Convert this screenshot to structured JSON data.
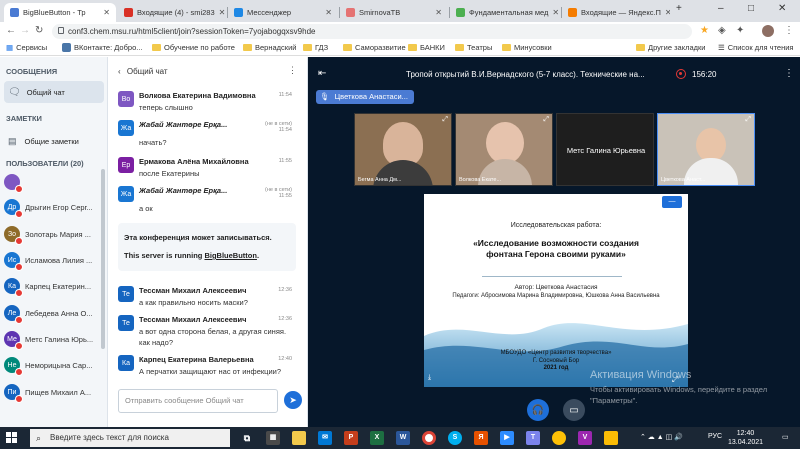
{
  "browser": {
    "tabs": [
      {
        "label": "BigBlueButton - Тр",
        "color": "#4b7bd3",
        "active": true
      },
      {
        "label": "Входящие (4) - smi283",
        "color": "#d93025",
        "active": false
      },
      {
        "label": "Мессенджер",
        "color": "#1e88e5",
        "active": false
      },
      {
        "label": "SmirnovaTB",
        "color": "#e57373",
        "active": false
      },
      {
        "label": "Фундаментальная мед",
        "color": "#4caf50",
        "active": false
      },
      {
        "label": "Входящие — Яндекс.П",
        "color": "#f57c00",
        "active": false
      }
    ],
    "url": "conf3.chem.msu.ru/html5client/join?sessionToken=7yojabogqxsv9hde",
    "bookmarks": [
      {
        "label": "Сервисы",
        "kind": "apps"
      },
      {
        "label": "ВКонтакте: Добро...",
        "kind": "vk"
      },
      {
        "label": "Обучение по работе",
        "kind": "folder"
      },
      {
        "label": "Вернадский",
        "kind": "folder"
      },
      {
        "label": "ГДЗ",
        "kind": "folder"
      },
      {
        "label": "Саморазвитие",
        "kind": "folder"
      },
      {
        "label": "БАНКИ",
        "kind": "folder"
      },
      {
        "label": "Театры",
        "kind": "folder"
      },
      {
        "label": "Минусовки",
        "kind": "folder"
      },
      {
        "label": "Другие закладки",
        "kind": "folder"
      },
      {
        "label": "Список для чтения",
        "kind": "list"
      }
    ]
  },
  "sidebar": {
    "messages_heading": "СООБЩЕНИЯ",
    "public_chat": "Общий чат",
    "notes_heading": "ЗАМЕТКИ",
    "shared_notes": "Общие заметки",
    "users_heading": "ПОЛЬЗОВАТЕЛИ (20)",
    "users": [
      {
        "initials": "",
        "name": "",
        "color": "#7e57c2"
      },
      {
        "initials": "Др",
        "name": "Дрыгин Егор Серг...",
        "color": "#1976d2"
      },
      {
        "initials": "Зо",
        "name": "Золотарь Мария ...",
        "color": "#8e6b2a"
      },
      {
        "initials": "Ис",
        "name": "Исламова Лилия ...",
        "color": "#1976d2"
      },
      {
        "initials": "Ка",
        "name": "Карпец Екатерин...",
        "color": "#1565c0"
      },
      {
        "initials": "Ле",
        "name": "Лебедева Анна О...",
        "color": "#1565c0"
      },
      {
        "initials": "Ме",
        "name": "Метс Галина Юрь...",
        "color": "#5e35b1"
      },
      {
        "initials": "Не",
        "name": "Неморицына Сар...",
        "color": "#00897b"
      },
      {
        "initials": "Пи",
        "name": "Пищев Михаил А...",
        "color": "#1565c0"
      }
    ]
  },
  "chat": {
    "title": "Общий чат",
    "messages": [
      {
        "initials": "Во",
        "color": "#7e57c2",
        "name": "Волкова Екатерина Вадимовна",
        "time": "11:54",
        "text": "теперь слышно",
        "offline": false
      },
      {
        "initials": "Жа",
        "color": "#1976d2",
        "name": "Жабай Жантөре Ерқа...",
        "time": "11:54",
        "offline_label": "(не в сети)",
        "text": "начать?",
        "offline": true
      },
      {
        "initials": "Ер",
        "color": "#7b1fa2",
        "name": "Ермакова Алёна Михайловна",
        "time": "11:55",
        "text": "после Екатерины",
        "offline": false
      },
      {
        "initials": "Жа",
        "color": "#1976d2",
        "name": "Жабай Жантөре Ерқа...",
        "time": "11:55",
        "offline_label": "(не в сети)",
        "text": "а ок",
        "offline": true
      },
      {
        "initials": "Те",
        "color": "#1565c0",
        "name": "Тессман Михаил Алексеевич",
        "time": "12:36",
        "text": "а как правильно носить маски?",
        "offline": false
      },
      {
        "initials": "Те",
        "color": "#1565c0",
        "name": "Тессман Михаил Алексеевич",
        "time": "12:36",
        "text": "а вот одна сторона белая, а другая синяя. как надо?",
        "offline": false
      },
      {
        "initials": "Ка",
        "color": "#1565c0",
        "name": "Карпец Екатерина Валерьевна",
        "time": "12:40",
        "text": "А перчатки защищают нас от инфекции?",
        "offline": false
      }
    ],
    "system_line1": "Эта конференция может записываться.",
    "system_line2_prefix": "This server is running ",
    "system_line2_link": "BigBlueButton",
    "input_placeholder": "Отправить сообщение Общий чат"
  },
  "conference": {
    "title": "Тропой открытий В.И.Вернадского (5-7 класс). Технические на...",
    "timer": "156:20",
    "current_speaker": "Цветкова Анастаси...",
    "videos": [
      {
        "name": "Бегма Анна Дм...",
        "bg": "#8b6f52",
        "center": "",
        "active": false
      },
      {
        "name": "Волкова Екате...",
        "bg": "#a48a73",
        "center": "",
        "active": false
      },
      {
        "name": "",
        "bg": "#1e1e1e",
        "center": "Метс Галина Юрьевна",
        "active": false
      },
      {
        "name": "Цветкова Анаст...",
        "bg": "#c9c2b8",
        "center": "",
        "active": true
      }
    ],
    "slide": {
      "kind": "Исследовательская работа:",
      "title_l1": "«Исследование возможности создания",
      "title_l2": "фонтана Герона своими руками»",
      "author": "Автор: Цветкова Анастасия",
      "teachers": "Педагоги: Абросимова Марина Владимировна, Юшкова Анна Васильевна",
      "org_l1": "МБОУДО «Центр развития творчества»",
      "org_l2": "Г. Сосновый Бор",
      "year": "2021 год"
    },
    "watermark_title": "Активация Windows",
    "watermark_text": "Чтобы активировать Windows, перейдите в раздел \"Параметры\"."
  },
  "taskbar": {
    "search_placeholder": "Введите здесь текст для поиска",
    "time": "12:40",
    "date": "13.04.2021",
    "lang": "РУС"
  }
}
